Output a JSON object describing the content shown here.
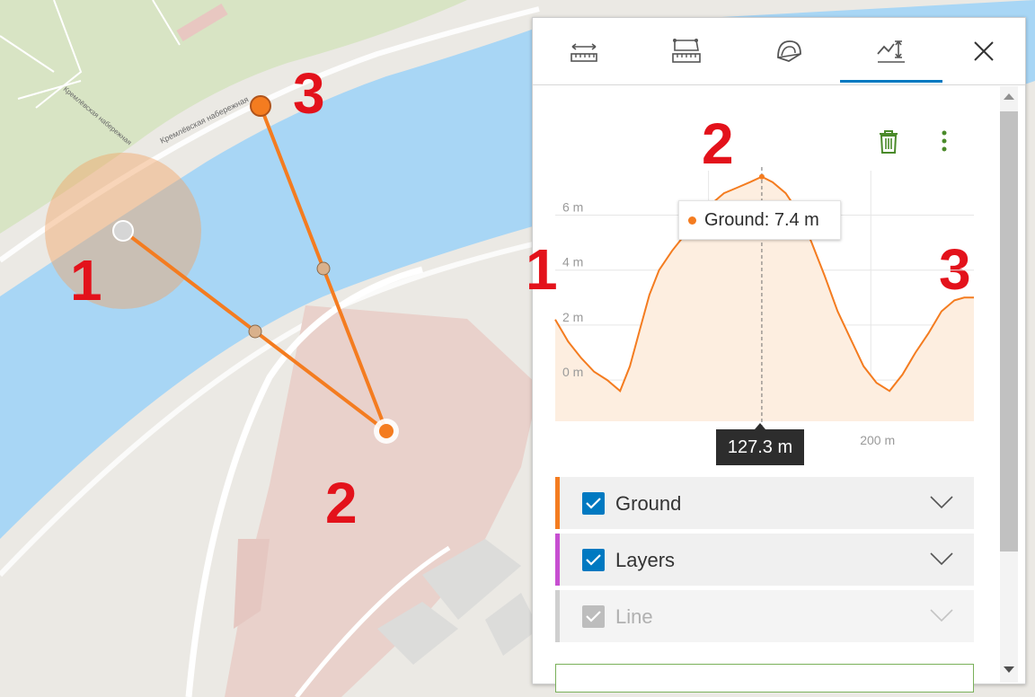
{
  "map": {
    "street_labels": [
      "Кремлёвская набережная",
      "Кремлёвская набережная"
    ],
    "annotations": [
      "1",
      "2",
      "3"
    ]
  },
  "panel": {
    "tabs": [
      {
        "name": "distance-measurement",
        "icon": "ruler-distance-icon"
      },
      {
        "name": "area-measurement",
        "icon": "ruler-area-icon"
      },
      {
        "name": "slice",
        "icon": "slice-icon"
      },
      {
        "name": "elevation-profile",
        "icon": "elevation-profile-icon",
        "active": true
      }
    ],
    "close_icon": "close-icon",
    "delete_icon": "trash-icon",
    "more_icon": "more-vertical-icon",
    "annotations": {
      "left": "1",
      "mid": "2",
      "right": "3"
    },
    "tooltip": "Ground: 7.4 m",
    "x_readout": "127.3 m",
    "legend": [
      {
        "label": "Ground",
        "color": "#f47c20",
        "checked": true,
        "disabled": false
      },
      {
        "label": "Layers",
        "color": "#c74fd1",
        "checked": true,
        "disabled": false
      },
      {
        "label": "Line",
        "color": "#cfcfcf",
        "checked": true,
        "disabled": true
      }
    ]
  },
  "chart_data": {
    "type": "area",
    "title": "",
    "xlabel": "",
    "ylabel": "",
    "y_ticks": [
      "0 m",
      "2 m",
      "4 m",
      "6 m"
    ],
    "x_ticks": [
      "200 m"
    ],
    "ylim": [
      -1.5,
      8.6
    ],
    "xlim": [
      0,
      258
    ],
    "series": [
      {
        "name": "Ground",
        "color": "#f47c20",
        "x": [
          0,
          8,
          16,
          24,
          32,
          40,
          46,
          52,
          58,
          64,
          72,
          80,
          88,
          96,
          104,
          112,
          120,
          127.3,
          134,
          142,
          150,
          158,
          166,
          174,
          182,
          190,
          198,
          206,
          214,
          222,
          230,
          238,
          246,
          252,
          258
        ],
        "y": [
          2.2,
          1.4,
          0.8,
          0.3,
          0.0,
          -0.4,
          0.5,
          1.8,
          3.1,
          4.0,
          4.7,
          5.3,
          5.9,
          6.4,
          6.8,
          7.0,
          7.2,
          7.4,
          7.2,
          6.8,
          6.1,
          5.0,
          3.8,
          2.5,
          1.5,
          0.5,
          -0.1,
          -0.4,
          0.2,
          1.0,
          1.7,
          2.5,
          2.9,
          3.0,
          3.0
        ]
      }
    ],
    "cursor_x": 127.3,
    "grid": true
  }
}
